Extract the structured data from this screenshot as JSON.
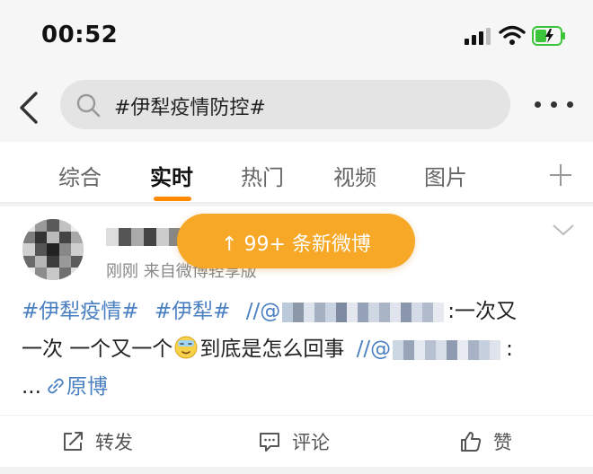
{
  "status_bar": {
    "time": "00:52",
    "battery_color": "#3cc43c"
  },
  "search": {
    "query": "#伊犁疫情防控#"
  },
  "tabs": [
    "综合",
    "实时",
    "热门",
    "视频",
    "图片"
  ],
  "active_tab": "实时",
  "accent_color": "#ff8a00",
  "link_color": "#4a7fc1",
  "toast": {
    "label": "↑ 99+ 条新微博",
    "color": "#f6a826"
  },
  "post": {
    "meta": "刚刚  来自微博轻享版",
    "line1": {
      "tag1": "#伊犁疫情#",
      "tag2": "#伊犁#",
      "sep": "//@",
      "text": ":一次又"
    },
    "line2": {
      "text": "一次 一个又一个",
      "text2": "到底是怎么回事",
      "sep": "//@",
      "end": ":"
    },
    "line3": {
      "ellipsis": "...",
      "link": "原博"
    }
  },
  "actions": {
    "repost": "转发",
    "comment": "评论",
    "like": "赞"
  },
  "icons": [
    "back-icon",
    "search-icon",
    "more-icon",
    "plus-icon",
    "chevron-down-icon",
    "link-icon",
    "repost-icon",
    "comment-icon",
    "like-icon"
  ]
}
